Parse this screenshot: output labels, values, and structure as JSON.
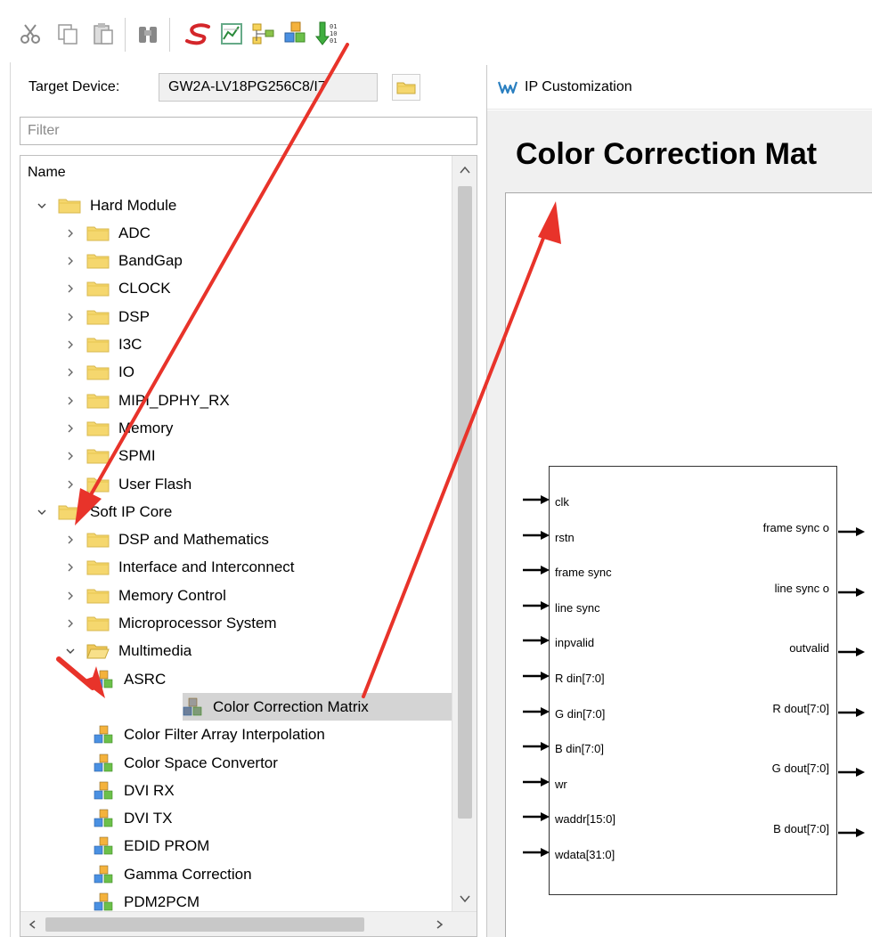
{
  "toolbar": {
    "icons": [
      "cut-icon",
      "copy-icon",
      "paste-icon",
      "find-icon",
      "synthesize-icon",
      "timing-icon",
      "hierarchy-icon",
      "ip-core-icon",
      "program-device-icon"
    ]
  },
  "target": {
    "label": "Target Device:",
    "value": "GW2A-LV18PG256C8/I7"
  },
  "filter": {
    "placeholder": "Filter"
  },
  "tree": {
    "header": "Name",
    "rows": [
      {
        "label": "Hard Module",
        "kind": "folder",
        "level": 0,
        "expanded": true
      },
      {
        "label": "ADC",
        "kind": "folder",
        "level": 1,
        "expanded": false
      },
      {
        "label": "BandGap",
        "kind": "folder",
        "level": 1,
        "expanded": false
      },
      {
        "label": "CLOCK",
        "kind": "folder",
        "level": 1,
        "expanded": false
      },
      {
        "label": "DSP",
        "kind": "folder",
        "level": 1,
        "expanded": false
      },
      {
        "label": "I3C",
        "kind": "folder",
        "level": 1,
        "expanded": false
      },
      {
        "label": "IO",
        "kind": "folder",
        "level": 1,
        "expanded": false
      },
      {
        "label": "MIPI_DPHY_RX",
        "kind": "folder",
        "level": 1,
        "expanded": false
      },
      {
        "label": "Memory",
        "kind": "folder",
        "level": 1,
        "expanded": false
      },
      {
        "label": "SPMI",
        "kind": "folder",
        "level": 1,
        "expanded": false
      },
      {
        "label": "User Flash",
        "kind": "folder",
        "level": 1,
        "expanded": false
      },
      {
        "label": "Soft IP Core",
        "kind": "folder",
        "level": 0,
        "expanded": true
      },
      {
        "label": "DSP and Mathematics",
        "kind": "folder",
        "level": 1,
        "expanded": false
      },
      {
        "label": "Interface and Interconnect",
        "kind": "folder",
        "level": 1,
        "expanded": false
      },
      {
        "label": "Memory Control",
        "kind": "folder",
        "level": 1,
        "expanded": false
      },
      {
        "label": "Microprocessor System",
        "kind": "folder",
        "level": 1,
        "expanded": false
      },
      {
        "label": "Multimedia",
        "kind": "folder-open",
        "level": 1,
        "expanded": true
      },
      {
        "label": "ASRC",
        "kind": "ip",
        "level": 2
      },
      {
        "label": "Color Correction Matrix",
        "kind": "ip-selected",
        "level": 2,
        "selected": true
      },
      {
        "label": "Color Filter Array Interpolation",
        "kind": "ip",
        "level": 2
      },
      {
        "label": "Color Space Convertor",
        "kind": "ip",
        "level": 2
      },
      {
        "label": "DVI RX",
        "kind": "ip",
        "level": 2
      },
      {
        "label": "DVI TX",
        "kind": "ip",
        "level": 2
      },
      {
        "label": "EDID PROM",
        "kind": "ip",
        "level": 2
      },
      {
        "label": "Gamma Correction",
        "kind": "ip",
        "level": 2
      },
      {
        "label": "PDM2PCM",
        "kind": "ip",
        "level": 2
      }
    ]
  },
  "ip_window": {
    "title": "IP Customization",
    "heading": "Color Correction Mat",
    "inputs": [
      "clk",
      "rstn",
      "frame sync",
      "line sync",
      "inpvalid",
      "R din[7:0]",
      "G din[7:0]",
      "B din[7:0]",
      "wr",
      "waddr[15:0]",
      "wdata[31:0]"
    ],
    "outputs": [
      "frame sync o",
      "line sync o",
      "outvalid",
      "R dout[7:0]",
      "G dout[7:0]",
      "B dout[7:0]"
    ]
  },
  "colors": {
    "annotation": "#e8332a",
    "folder": "#f5d76e",
    "selected_row": "#d4d4d4"
  }
}
